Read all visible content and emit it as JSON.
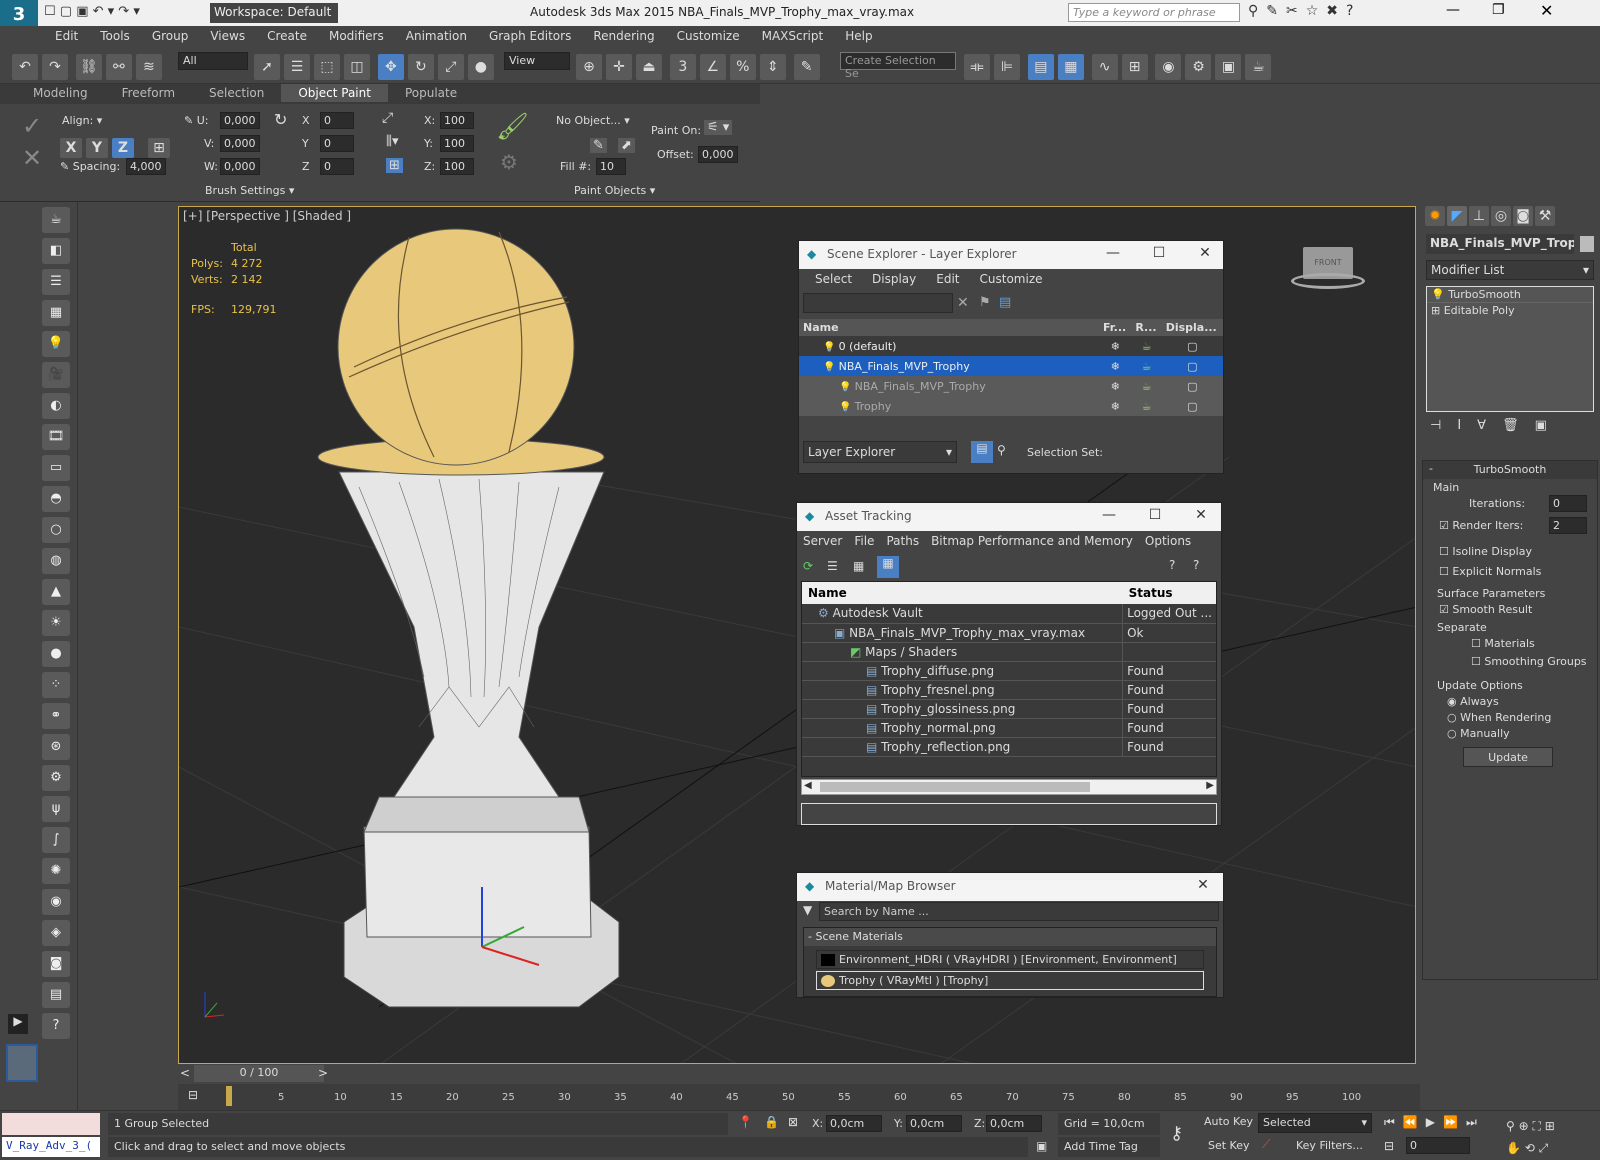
{
  "window": {
    "title": "Autodesk 3ds Max  2015    NBA_Finals_MVP_Trophy_max_vray.max",
    "workspace": "Workspace: Default",
    "search_placeholder": "Type a keyword or phrase"
  },
  "menu": [
    "Edit",
    "Tools",
    "Group",
    "Views",
    "Create",
    "Modifiers",
    "Animation",
    "Graph Editors",
    "Rendering",
    "Customize",
    "MAXScript",
    "Help"
  ],
  "toolbar": {
    "filter": "All",
    "ref_coord": "View",
    "selection_set": "Create Selection Se"
  },
  "ribbon": {
    "tabs": [
      "Modeling",
      "Freeform",
      "Selection",
      "Object Paint",
      "Populate"
    ],
    "active_tab": "Object Paint",
    "align_label": "Align:",
    "axes": [
      "X",
      "Y",
      "Z"
    ],
    "spacing_label": "Spacing:",
    "spacing_value": "4,000",
    "u_label": "U:",
    "u_value": "0,000",
    "v_label": "V:",
    "v_value": "0,000",
    "w_label": "W:",
    "w_value": "0,000",
    "rx_label": "X",
    "rx_value": "0",
    "ry_label": "Y",
    "ry_value": "0",
    "rz_label": "Z",
    "rz_value": "0",
    "sx_label": "X:",
    "sx_value": "100",
    "sy_label": "Y:",
    "sy_value": "100",
    "sz_label": "Z:",
    "sz_value": "100",
    "brush_settings": "Brush Settings",
    "no_object": "No Object...",
    "fill_label": "Fill #:",
    "fill_value": "10",
    "paint_on_label": "Paint On:",
    "offset_label": "Offset:",
    "offset_value": "0,000",
    "paint_objects": "Paint Objects"
  },
  "viewport": {
    "label": "[+] [Perspective ] [Shaded ]",
    "stats_total": "Total",
    "polys_label": "Polys:",
    "polys_value": "4 272",
    "verts_label": "Verts:",
    "verts_value": "2 142",
    "fps_label": "FPS:",
    "fps_value": "129,791",
    "viewcube_label": "FRONT"
  },
  "scene_explorer": {
    "title": "Scene Explorer - Layer Explorer",
    "menu": [
      "Select",
      "Display",
      "Edit",
      "Customize"
    ],
    "columns": [
      "Name",
      "Fr...",
      "R...",
      "Displa..."
    ],
    "rows": [
      {
        "name": "0 (default)",
        "selected": false,
        "child": false
      },
      {
        "name": "NBA_Finals_MVP_Trophy",
        "selected": true,
        "child": false
      },
      {
        "name": "NBA_Finals_MVP_Trophy",
        "selected": false,
        "child": true
      },
      {
        "name": "Trophy",
        "selected": false,
        "child": true
      }
    ],
    "footer_dropdown": "Layer Explorer",
    "selection_set_label": "Selection Set:"
  },
  "asset_tracking": {
    "title": "Asset Tracking",
    "menu": [
      "Server",
      "File",
      "Paths",
      "Bitmap Performance and Memory",
      "Options"
    ],
    "columns": [
      "Name",
      "Status"
    ],
    "rows": [
      {
        "name": "Autodesk Vault",
        "status": "Logged Out ...",
        "indent": 1
      },
      {
        "name": "NBA_Finals_MVP_Trophy_max_vray.max",
        "status": "Ok",
        "indent": 2
      },
      {
        "name": "Maps / Shaders",
        "status": "",
        "indent": 3
      },
      {
        "name": "Trophy_diffuse.png",
        "status": "Found",
        "indent": 4
      },
      {
        "name": "Trophy_fresnel.png",
        "status": "Found",
        "indent": 4
      },
      {
        "name": "Trophy_glossiness.png",
        "status": "Found",
        "indent": 4
      },
      {
        "name": "Trophy_normal.png",
        "status": "Found",
        "indent": 4
      },
      {
        "name": "Trophy_reflection.png",
        "status": "Found",
        "indent": 4
      }
    ]
  },
  "material_browser": {
    "title": "Material/Map Browser",
    "search_placeholder": "Search by Name ...",
    "section": "- Scene Materials",
    "items": [
      "Environment_HDRI ( VRayHDRI ) [Environment, Environment]",
      "Trophy ( VRayMtl ) [Trophy]"
    ]
  },
  "command_panel": {
    "object_name": "NBA_Finals_MVP_Trophy",
    "modifier_list": "Modifier List",
    "stack": [
      "TurboSmooth",
      "Editable Poly"
    ],
    "rollout_title": "TurboSmooth",
    "main_label": "Main",
    "iterations_label": "Iterations:",
    "iterations_value": "0",
    "render_iters_label": "Render Iters:",
    "render_iters_value": "2",
    "isoline": "Isoline Display",
    "explicit_normals": "Explicit Normals",
    "surface_params": "Surface Parameters",
    "smooth_result": "Smooth Result",
    "separate": "Separate",
    "materials": "Materials",
    "smoothing_groups": "Smoothing Groups",
    "update_options": "Update Options",
    "always": "Always",
    "when_rendering": "When Rendering",
    "manually": "Manually",
    "update_button": "Update"
  },
  "timeline": {
    "frame_display": "0 / 100",
    "ticks": [
      "5",
      "10",
      "15",
      "20",
      "25",
      "30",
      "35",
      "40",
      "45",
      "50",
      "55",
      "60",
      "65",
      "70",
      "75",
      "80",
      "85",
      "90",
      "95",
      "100"
    ]
  },
  "status": {
    "script_listener": "V_Ray_Adv_3_(",
    "selection": "1 Group Selected",
    "hint": "Click and drag to select and move objects",
    "x_label": "X:",
    "x_value": "0,0cm",
    "y_label": "Y:",
    "y_value": "0,0cm",
    "z_label": "Z:",
    "z_value": "0,0cm",
    "grid": "Grid = 10,0cm",
    "add_time_tag": "Add Time Tag",
    "auto_key": "Auto Key",
    "set_key": "Set Key",
    "selected_dropdown": "Selected",
    "key_filters": "Key Filters...",
    "frame_field": "0"
  },
  "colors": {
    "selection_blue": "#1c5fbf",
    "viewport_border": "#c8a84b",
    "ball_gold": "#e8c87a"
  }
}
